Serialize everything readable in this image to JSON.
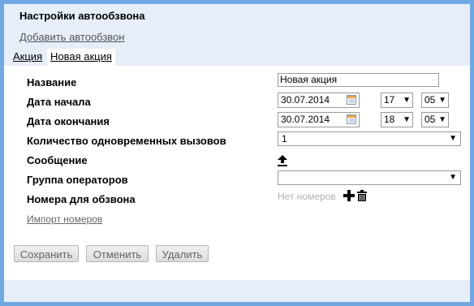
{
  "header": {
    "title": "Настройки автообзвона",
    "add_link": "Добавить автообзвон"
  },
  "tabs": [
    {
      "label": "Акция"
    },
    {
      "label": "Новая акция"
    }
  ],
  "form": {
    "name_label": "Название",
    "name_value": "Новая акция",
    "start_label": "Дата начала",
    "start_date": "30.07.2014",
    "start_hour": "17",
    "start_minute": "05",
    "end_label": "Дата окончания",
    "end_date": "30.07.2014",
    "end_hour": "18",
    "end_minute": "05",
    "concurrent_label": "Количество одновременных вызовов",
    "concurrent_value": "1",
    "message_label": "Сообщение",
    "group_label": "Группа операторов",
    "group_value": "",
    "numbers_label": "Номера для обзвона",
    "no_numbers_text": "Нет номеров",
    "import_link": "Импорт номеров"
  },
  "buttons": {
    "save": "Сохранить",
    "cancel": "Отменить",
    "delete": "Удалить"
  },
  "icons": {
    "upload": "upload-icon",
    "add": "plus-icon",
    "delete": "trash-icon",
    "calendar": "calendar-icon",
    "dropdown": "triangle-down-icon"
  },
  "colors": {
    "border": "#6fa8e3",
    "panel": "#e6eef9"
  }
}
